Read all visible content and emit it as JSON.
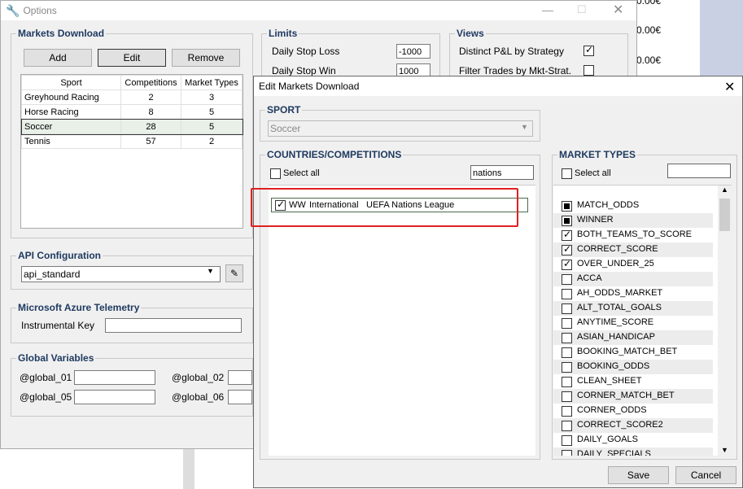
{
  "background": {
    "cells": [
      "0.00€",
      "0.00€",
      "0.00€"
    ]
  },
  "options_window": {
    "title": "Options",
    "markets_download": {
      "title": "Markets Download",
      "add_label": "Add",
      "edit_label": "Edit",
      "remove_label": "Remove",
      "columns": [
        "Sport",
        "Competitions",
        "Market Types"
      ],
      "rows": [
        [
          "Greyhound Racing",
          "2",
          "3"
        ],
        [
          "Horse Racing",
          "8",
          "5"
        ],
        [
          "Soccer",
          "28",
          "5"
        ],
        [
          "Tennis",
          "57",
          "2"
        ]
      ]
    },
    "limits": {
      "title": "Limits",
      "daily_stop_loss_label": "Daily Stop Loss",
      "daily_stop_loss_value": "-1000",
      "daily_stop_win_label": "Daily Stop Win",
      "daily_stop_win_value": "1000"
    },
    "views": {
      "title": "Views",
      "distinct_pl_label": "Distinct P&L by Strategy",
      "filter_trades_label": "Filter Trades by Mkt-Strat."
    },
    "api": {
      "title": "API Configuration",
      "value": "api_standard"
    },
    "azure": {
      "title": "Microsoft Azure Telemetry",
      "key_label": "Instrumental Key"
    },
    "global_vars": {
      "title": "Global Variables",
      "labels": [
        "@global_01",
        "@global_02",
        "@global_05",
        "@global_06"
      ]
    }
  },
  "edit_dialog": {
    "title": "Edit Markets Download",
    "sport": {
      "title": "SPORT",
      "value": "Soccer"
    },
    "countries": {
      "title": "COUNTRIES/COMPETITIONS",
      "select_all_label": "Select all",
      "filter_value": "nations",
      "rows": [
        {
          "code": "WW",
          "region": "International",
          "name": "UEFA Nations League"
        }
      ]
    },
    "market_types": {
      "title": "MARKET TYPES",
      "select_all_label": "Select all",
      "items": [
        {
          "label": "MATCH_ODDS",
          "state": "filled"
        },
        {
          "label": "WINNER",
          "state": "filled"
        },
        {
          "label": "BOTH_TEAMS_TO_SCORE",
          "state": "checked"
        },
        {
          "label": "CORRECT_SCORE",
          "state": "checked"
        },
        {
          "label": "OVER_UNDER_25",
          "state": "checked"
        },
        {
          "label": "ACCA",
          "state": "none"
        },
        {
          "label": "AH_ODDS_MARKET",
          "state": "none"
        },
        {
          "label": "ALT_TOTAL_GOALS",
          "state": "none"
        },
        {
          "label": "ANYTIME_SCORE",
          "state": "none"
        },
        {
          "label": "ASIAN_HANDICAP",
          "state": "none"
        },
        {
          "label": "BOOKING_MATCH_BET",
          "state": "none"
        },
        {
          "label": "BOOKING_ODDS",
          "state": "none"
        },
        {
          "label": "CLEAN_SHEET",
          "state": "none"
        },
        {
          "label": "CORNER_MATCH_BET",
          "state": "none"
        },
        {
          "label": "CORNER_ODDS",
          "state": "none"
        },
        {
          "label": "CORRECT_SCORE2",
          "state": "none"
        },
        {
          "label": "DAILY_GOALS",
          "state": "none"
        },
        {
          "label": "DAILY_SPECIALS",
          "state": "none"
        }
      ]
    },
    "save_label": "Save",
    "cancel_label": "Cancel"
  }
}
